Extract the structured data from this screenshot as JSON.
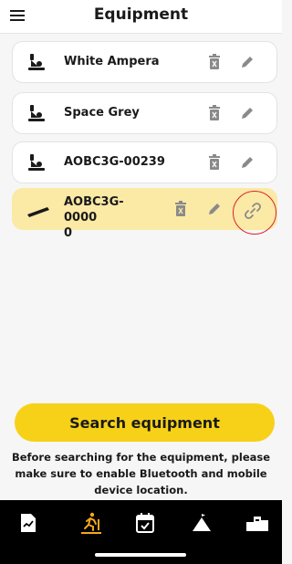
{
  "header": {
    "title": "Equipment",
    "menu_icon": "hamburger-menu-icon"
  },
  "devices": [
    {
      "name": "White Ampera",
      "icon": "exercise-bike-icon",
      "selected": false
    },
    {
      "name": "Space Grey",
      "icon": "exercise-bike-icon",
      "selected": false
    },
    {
      "name": "AOBC3G-00239",
      "icon": "exercise-bike-icon",
      "selected": false
    },
    {
      "name": "AOBC3G-0000\n0",
      "icon": "treadmill-icon",
      "selected": true
    }
  ],
  "actions": {
    "delete_icon": "trash-icon",
    "edit_icon": "pencil-icon",
    "link_icon": "link-icon"
  },
  "search": {
    "button_label": "Search equipment",
    "hint": "Before searching for the equipment, please make sure to enable Bluetooth and mobile device location."
  },
  "tabs": [
    {
      "icon": "report-icon",
      "active": false
    },
    {
      "icon": "workout-icon",
      "active": true
    },
    {
      "icon": "calendar-check-icon",
      "active": false
    },
    {
      "icon": "climb-icon",
      "active": false
    },
    {
      "icon": "podium-icon",
      "active": false
    }
  ],
  "colors": {
    "accent": "#f6d118",
    "selected_card": "#fbe9a6",
    "highlight_ring": "#d9232d",
    "active_tab": "#f6a81b",
    "tabbar": "#000000"
  }
}
